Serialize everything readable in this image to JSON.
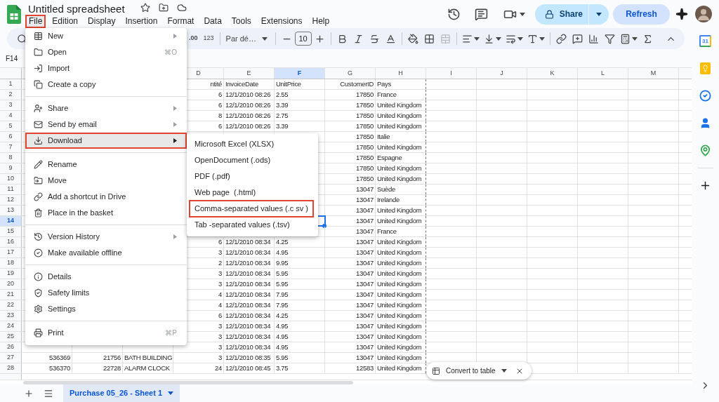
{
  "document": {
    "title": "Untitled spreadsheet"
  },
  "menu_bar": [
    {
      "label": "File",
      "selected": true
    },
    {
      "label": "Edition",
      "selected": false
    },
    {
      "label": "Display",
      "selected": false
    },
    {
      "label": "Insertion",
      "selected": false
    },
    {
      "label": "Format",
      "selected": false
    },
    {
      "label": "Data",
      "selected": false
    },
    {
      "label": "Tools",
      "selected": false
    },
    {
      "label": "Extensions",
      "selected": false
    },
    {
      "label": "Help",
      "selected": false
    }
  ],
  "header_buttons": {
    "share": "Share",
    "refresh": "Refresh"
  },
  "toolbar": {
    "decimal": ".00",
    "number_format": "123",
    "font": "Par dé…",
    "font_size": "10"
  },
  "name_box": "F14",
  "grid": {
    "columns": [
      {
        "label": "D",
        "selected": false
      },
      {
        "label": "E",
        "selected": false
      },
      {
        "label": "F",
        "selected": true
      },
      {
        "label": "G",
        "selected": false
      },
      {
        "label": "H",
        "selected": false
      },
      {
        "label": "I",
        "selected": false
      },
      {
        "label": "J",
        "selected": false
      },
      {
        "label": "K",
        "selected": false
      },
      {
        "label": "L",
        "selected": false
      },
      {
        "label": "M",
        "selected": false
      }
    ],
    "rows": [
      {
        "number": "1",
        "selected": false,
        "d": "ntité",
        "e": "InvoiceDate",
        "f": "UnitPrice",
        "g": "CustomerID",
        "h": "Pays"
      },
      {
        "number": "2",
        "selected": false,
        "d": "6",
        "e": "12/1/2010 08:26",
        "f": "2.55",
        "g": "17850",
        "h": "France"
      },
      {
        "number": "3",
        "selected": false,
        "d": "6",
        "e": "12/1/2010 08:26",
        "f": "3.39",
        "g": "17850",
        "h": "United Kingdom"
      },
      {
        "number": "4",
        "selected": false,
        "d": "8",
        "e": "12/1/2010 08:26",
        "f": "2.75",
        "g": "17850",
        "h": "United Kingdom"
      },
      {
        "number": "5",
        "selected": false,
        "d": "6",
        "e": "12/1/2010 08:26",
        "f": "3.39",
        "g": "17850",
        "h": "United Kingdom"
      },
      {
        "number": "6",
        "selected": false,
        "g": "17850",
        "h": "Italie"
      },
      {
        "number": "7",
        "selected": false,
        "g": "17850",
        "h": "United Kingdom"
      },
      {
        "number": "8",
        "selected": false,
        "g": "17850",
        "h": "Espagne"
      },
      {
        "number": "9",
        "selected": false,
        "g": "17850",
        "h": "United Kingdom"
      },
      {
        "number": "10",
        "selected": false,
        "g": "17850",
        "h": "United Kingdom"
      },
      {
        "number": "11",
        "selected": false,
        "g": "13047",
        "h": "Suède"
      },
      {
        "number": "12",
        "selected": false,
        "g": "13047",
        "h": "Irelande"
      },
      {
        "number": "13",
        "selected": false,
        "g": "13047",
        "h": "United Kingdom"
      },
      {
        "number": "14",
        "selected": true,
        "g": "13047",
        "h": "United Kingdom"
      },
      {
        "number": "15",
        "selected": false,
        "g": "13047",
        "h": "France"
      },
      {
        "number": "16",
        "selected": false,
        "d": "6",
        "e": "12/1/2010 08:34",
        "f": "4.25",
        "g": "13047",
        "h": "United Kingdom"
      },
      {
        "number": "17",
        "selected": false,
        "d": "3",
        "e": "12/1/2010 08:34",
        "f": "4.95",
        "g": "13047",
        "h": "United Kingdom"
      },
      {
        "number": "18",
        "selected": false,
        "d": "2",
        "e": "12/1/2010 08:34",
        "f": "9.95",
        "g": "13047",
        "h": "United Kingdom"
      },
      {
        "number": "19",
        "selected": false,
        "d": "3",
        "e": "12/1/2010 08:34",
        "f": "5.95",
        "g": "13047",
        "h": "United Kingdom"
      },
      {
        "number": "20",
        "selected": false,
        "d": "3",
        "e": "12/1/2010 08:34",
        "f": "5.95",
        "g": "13047",
        "h": "United Kingdom"
      },
      {
        "number": "21",
        "selected": false,
        "d": "4",
        "e": "12/1/2010 08:34",
        "f": "7.95",
        "g": "13047",
        "h": "United Kingdom"
      },
      {
        "number": "22",
        "selected": false,
        "d": "4",
        "e": "12/1/2010 08:34",
        "f": "7.95",
        "g": "13047",
        "h": "United Kingdom"
      },
      {
        "number": "23",
        "selected": false,
        "d": "6",
        "e": "12/1/2010 08:34",
        "f": "4.25",
        "g": "13047",
        "h": "United Kingdom"
      },
      {
        "number": "24",
        "selected": false,
        "d": "3",
        "e": "12/1/2010 08:34",
        "f": "4.95",
        "g": "13047",
        "h": "United Kingdom"
      },
      {
        "number": "25",
        "selected": false,
        "d": "3",
        "e": "12/1/2010 08:34",
        "f": "4.95",
        "g": "13047",
        "h": "United Kingdom"
      },
      {
        "number": "26",
        "selected": false,
        "d": "3",
        "e": "12/1/2010 08:34",
        "f": "4.95",
        "g": "13047",
        "h": "United Kingdom"
      },
      {
        "number": "27",
        "selected": false,
        "a": "536369",
        "b": "21756",
        "c": "BATH BUILDING",
        "d": "3",
        "e": "12/1/2010 08:35",
        "f": "5.95",
        "g": "13047",
        "h": "United Kingdom"
      },
      {
        "number": "28",
        "selected": false,
        "a": "536370",
        "b": "22728",
        "c": "ALARM CLOCK",
        "d": "24",
        "e": "12/1/2010 08:45",
        "f": "3.75",
        "g": "12583",
        "h": "United Kingdom"
      }
    ]
  },
  "file_menu": {
    "sections": [
      [
        {
          "label": "New",
          "submenu": true,
          "selected": false
        },
        {
          "label": "Open",
          "shortcut": "⌘O",
          "submenu": false,
          "selected": false
        },
        {
          "label": "Import",
          "submenu": false,
          "selected": false
        },
        {
          "label": "Create a copy",
          "submenu": false,
          "selected": false
        }
      ],
      [
        {
          "label": "Share",
          "submenu": true,
          "selected": false
        },
        {
          "label": "Send by email",
          "submenu": true,
          "selected": false
        },
        {
          "label": "Download",
          "submenu": true,
          "selected": true
        }
      ],
      [
        {
          "label": "Rename",
          "submenu": false,
          "selected": false
        },
        {
          "label": "Move",
          "submenu": false,
          "selected": false
        },
        {
          "label": "Add a shortcut in Drive",
          "submenu": false,
          "selected": false
        },
        {
          "label": "Place in the basket",
          "submenu": false,
          "selected": false
        }
      ],
      [
        {
          "label": "Version History",
          "submenu": true,
          "selected": false
        },
        {
          "label": "Make available offline",
          "submenu": false,
          "selected": false
        }
      ],
      [
        {
          "label": "Details",
          "submenu": false,
          "selected": false
        },
        {
          "label": "Safety limits",
          "submenu": false,
          "selected": false
        },
        {
          "label": "Settings",
          "submenu": false,
          "selected": false
        }
      ],
      [
        {
          "label": "Print",
          "shortcut": "⌘P",
          "submenu": false,
          "selected": false
        }
      ]
    ]
  },
  "download_menu": [
    {
      "label": "Microsoft Excel (XLSX)",
      "selected": false
    },
    {
      "label": "OpenDocument (.ods)",
      "selected": false
    },
    {
      "label": "PDF (.pdf)",
      "selected": false
    },
    {
      "label": "Web page  (.html)",
      "selected": false
    },
    {
      "label": "Comma-separated values (.c sv )",
      "selected": true
    },
    {
      "label": "Tab -separated values (.tsv)",
      "selected": false
    }
  ],
  "side_panel": {
    "calendar_day": "31"
  },
  "sheet_tabs": [
    {
      "label": "Purchase 05_26 - Sheet 1",
      "selected": true
    }
  ],
  "convert_chip": {
    "label": "Convert to table"
  }
}
